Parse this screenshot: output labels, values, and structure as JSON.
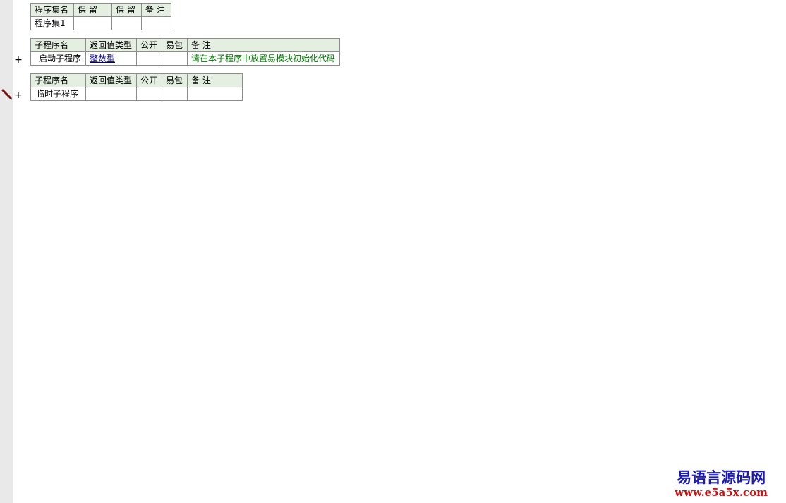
{
  "assembly_table": {
    "headers": [
      "程序集名",
      "保 留",
      "保 留",
      "备 注"
    ],
    "row": [
      "程序集1",
      "",
      "",
      ""
    ]
  },
  "subroutine_1": {
    "expand_symbol": "+",
    "headers": [
      "子程序名",
      "返回值类型",
      "公开",
      "易包",
      "备 注"
    ],
    "row": {
      "name": "_启动子程序",
      "return_type": "整数型",
      "public": "",
      "epackage": "",
      "remark": "请在本子程序中放置易模块初始化代码"
    }
  },
  "subroutine_2": {
    "expand_symbol": "+",
    "headers": [
      "子程序名",
      "返回值类型",
      "公开",
      "易包",
      "备 注"
    ],
    "row": {
      "name": "临时子程序",
      "return_type": "",
      "public": "",
      "epackage": "",
      "remark": ""
    }
  },
  "icons": {
    "edit_marker": "pencil-icon"
  },
  "watermark": {
    "title": "易语言源码网",
    "url": "www.e5a5x.com"
  },
  "colors": {
    "header_bg": "#e4efe2",
    "type_link": "#000080",
    "remark_green": "#007a00",
    "gutter": "#e9e9e9",
    "watermark_blue": "#1a1ab8",
    "watermark_red": "#cc1111"
  }
}
